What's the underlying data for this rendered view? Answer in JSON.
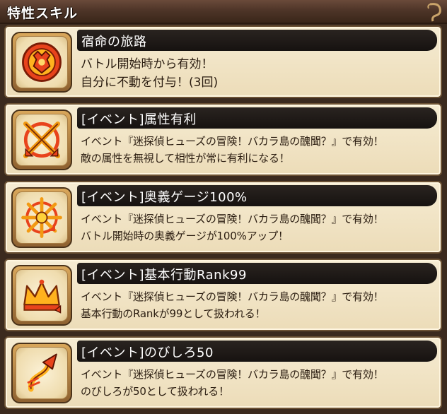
{
  "header": {
    "title": "特性スキル"
  },
  "skills": [
    {
      "name": "宿命の旅路",
      "icon": "fate-journey-icon",
      "lines": [
        "バトル開始時から有効！",
        "自分に不動を付与！(3回)"
      ]
    },
    {
      "name": "[イベント]属性有利",
      "icon": "attribute-advantage-icon",
      "lines": [
        "イベント『迷探偵ヒューズの冒険！バカラ島の醜聞？』で有効！",
        "敵の属性を無視して相性が常に有利になる！"
      ]
    },
    {
      "name": "[イベント]奥義ゲージ100%",
      "icon": "ougi-gauge-icon",
      "lines": [
        "イベント『迷探偵ヒューズの冒険！バカラ島の醜聞？』で有効！",
        "バトル開始時の奥義ゲージが100%アップ！"
      ]
    },
    {
      "name": "[イベント]基本行動Rank99",
      "icon": "crown-rank-icon",
      "lines": [
        "イベント『迷探偵ヒューズの冒険！バカラ島の醜聞？』で有効！",
        "基本行動のRankが99として扱われる！"
      ]
    },
    {
      "name": "[イベント]のびしろ50",
      "icon": "growth-arrow-icon",
      "lines": [
        "イベント『迷探偵ヒューズの冒険！バカラ島の醜聞？』で有効！",
        "のびしろが50として扱われる！"
      ]
    }
  ]
}
